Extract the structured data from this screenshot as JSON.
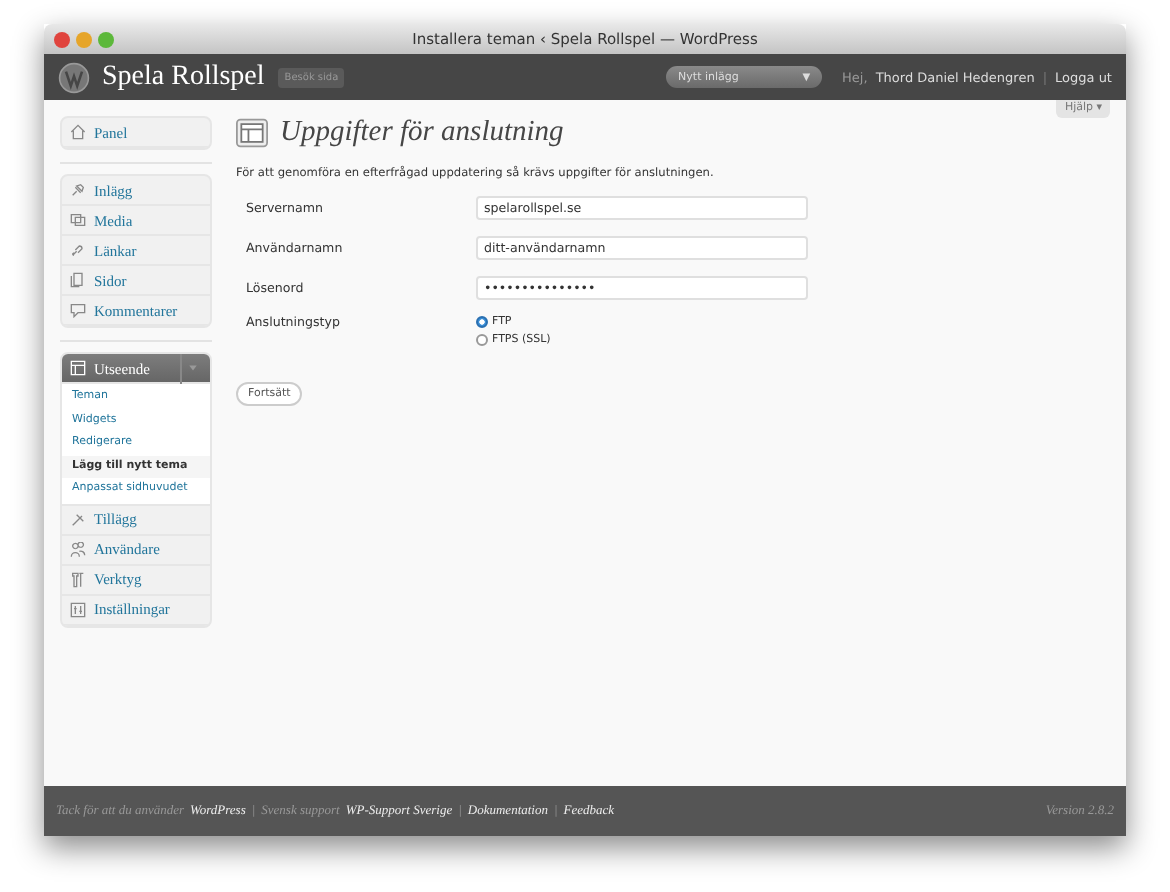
{
  "window": {
    "title": "Installera teman ‹ Spela Rollspel — WordPress"
  },
  "header": {
    "site_title": "Spela Rollspel",
    "visit_site": "Besök sida",
    "new_post": "Nytt inlägg",
    "new_post_caret": "▼",
    "greeting": "Hej,",
    "user": "Thord Daniel Hedengren",
    "separator": "|",
    "logout": "Logga ut"
  },
  "help": {
    "label": "Hjälp",
    "caret": "▾"
  },
  "sidebar": {
    "groups": [
      [
        {
          "label": "Panel",
          "selected": false
        }
      ],
      [
        {
          "label": "Inlägg",
          "selected": false
        },
        {
          "label": "Media",
          "selected": false
        },
        {
          "label": "Länkar",
          "selected": false
        },
        {
          "label": "Sidor",
          "selected": false
        },
        {
          "label": "Kommentarer",
          "selected": false
        }
      ],
      [
        {
          "label": "Utseende",
          "selected": true,
          "expanded": true,
          "children": [
            {
              "label": "Teman",
              "selected": false
            },
            {
              "label": "Widgets",
              "selected": false
            },
            {
              "label": "Redigerare",
              "selected": false
            },
            {
              "label": "Lägg till nytt tema",
              "selected": true
            },
            {
              "label": "Anpassat sidhuvudet",
              "selected": false
            }
          ]
        },
        {
          "label": "Tillägg",
          "selected": false
        },
        {
          "label": "Användare",
          "selected": false
        },
        {
          "label": "Verktyg",
          "selected": false
        },
        {
          "label": "Inställningar",
          "selected": false
        }
      ]
    ]
  },
  "page": {
    "title": "Uppgifter för anslutning",
    "intro": "För att genomföra en efterfrågad uppdatering så krävs uppgifter för anslutningen.",
    "fields": [
      {
        "label": "Servernamn",
        "value": "spelarollspel.se"
      },
      {
        "label": "Användarnamn",
        "value": "ditt-användarnamn"
      },
      {
        "label": "Lösenord",
        "value": "•••••••••••••••"
      }
    ],
    "connection_type": {
      "label": "Anslutningstyp",
      "options": [
        {
          "label": "FTP",
          "selected": true
        },
        {
          "label": "FTPS (SSL)",
          "selected": false
        }
      ]
    },
    "submit": "Fortsätt"
  },
  "footer": {
    "credits": [
      {
        "text": "Tack för att du använder",
        "link": false
      },
      {
        "text": "WordPress",
        "link": true
      },
      {
        "text": "|",
        "link": false
      },
      {
        "text": "Svensk support",
        "link": false
      },
      {
        "text": "WP-Support Sverige",
        "link": true
      },
      {
        "text": "|",
        "link": false
      },
      {
        "text": "Dokumentation",
        "link": true
      },
      {
        "text": "|",
        "link": false
      },
      {
        "text": "Feedback",
        "link": true
      }
    ],
    "version": "Version 2.8.2"
  }
}
